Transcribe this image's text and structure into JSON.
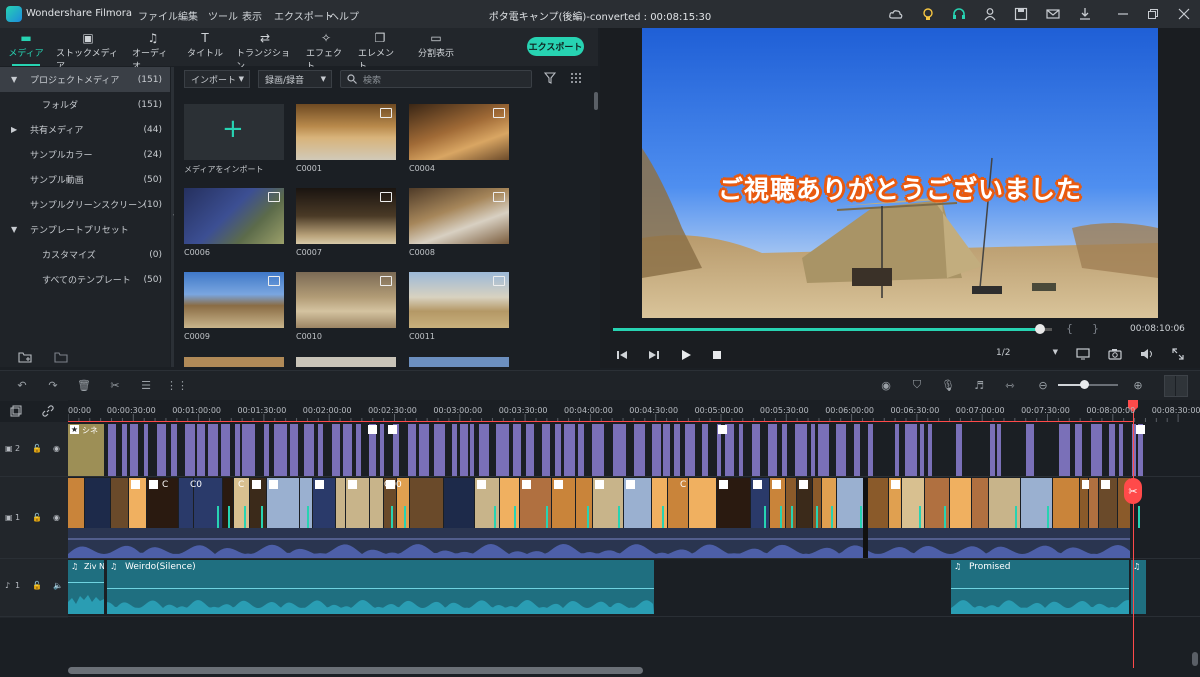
{
  "titlebar": {
    "app_name": "Wondershare Filmora",
    "menus": [
      "ファイル",
      "編集",
      "ツール",
      "表示",
      "エクスポート",
      "ヘルプ"
    ],
    "document_title": "ポタ電キャンプ(後編)-converted : 00:08:15:30"
  },
  "media_tabs": [
    {
      "label": "メディア",
      "icon": "folder-icon",
      "active": true
    },
    {
      "label": "ストックメディア",
      "icon": "stock-icon",
      "active": false
    },
    {
      "label": "オーディオ",
      "icon": "music-note-icon",
      "active": false
    },
    {
      "label": "タイトル",
      "icon": "title-t-icon",
      "active": false
    },
    {
      "label": "トランジション",
      "icon": "transition-icon",
      "active": false
    },
    {
      "label": "エフェクト",
      "icon": "effect-icon",
      "active": false
    },
    {
      "label": "エレメント",
      "icon": "element-icon",
      "active": false
    },
    {
      "label": "分割表示",
      "icon": "split-icon",
      "active": false
    }
  ],
  "export_label": "エクスポート",
  "tree": [
    {
      "label": "プロジェクトメディア",
      "count": "(151)",
      "expanded": true,
      "level": 0,
      "selected": true
    },
    {
      "label": "フォルダ",
      "count": "(151)",
      "level": 1
    },
    {
      "label": "共有メディア",
      "count": "(44)",
      "expanded": false,
      "level": 0
    },
    {
      "label": "サンプルカラー",
      "count": "(24)",
      "level": 0
    },
    {
      "label": "サンプル動画",
      "count": "(50)",
      "level": 0
    },
    {
      "label": "サンプルグリーンスクリーン",
      "count": "(10)",
      "level": 0
    },
    {
      "label": "テンプレートプリセット",
      "count": "",
      "expanded": true,
      "level": 0
    },
    {
      "label": "カスタマイズ",
      "count": "(0)",
      "level": 1
    },
    {
      "label": "すべてのテンプレート",
      "count": "(50)",
      "level": 1
    }
  ],
  "media_toolbar": {
    "import_label": "インポート",
    "record_label": "録画/録音",
    "search_placeholder": "検索"
  },
  "media_items": [
    {
      "caption": "メディアをインポート",
      "kind": "import"
    },
    {
      "caption": "C0001",
      "kind": "clip"
    },
    {
      "caption": "C0004",
      "kind": "clip"
    },
    {
      "caption": "C0006",
      "kind": "clip"
    },
    {
      "caption": "C0007",
      "kind": "clip"
    },
    {
      "caption": "C0008",
      "kind": "clip"
    },
    {
      "caption": "C0009",
      "kind": "clip"
    },
    {
      "caption": "C0010",
      "kind": "clip"
    },
    {
      "caption": "C0011",
      "kind": "clip"
    }
  ],
  "preview": {
    "subtitle": "ご視聴ありがとうございました",
    "timecode": "00:08:10:06",
    "progress": 0.972,
    "quality": "1/2",
    "bracket_in": "{",
    "bracket_out": "}"
  },
  "ruler_labels": [
    "00:00",
    "00:00:30:00",
    "00:01:00:00",
    "00:01:30:00",
    "00:02:00:00",
    "00:02:30:00",
    "00:03:00:00",
    "00:03:30:00",
    "00:04:00:00",
    "00:04:30:00",
    "00:05:00:00",
    "00:05:30:00",
    "00:06:00:00",
    "00:06:30:00",
    "00:07:00:00",
    "00:07:30:00",
    "00:08:00:00",
    "00:08:30:00"
  ],
  "tracks": {
    "fx_label": "2",
    "fx_clip_label": "シネ",
    "video_label": "1",
    "video_clip_labels": [
      "C",
      "C0",
      "C",
      "C00",
      "C"
    ],
    "audio_label": "1",
    "audio_clips": [
      "Ziv N",
      "Weirdo(Silence)",
      "Promised"
    ]
  },
  "colors": {
    "accent": "#27d3b2",
    "playhead": "#ff4a4a",
    "fx_clip": "#7a70b8",
    "audio_clip": "#1f6f80"
  }
}
